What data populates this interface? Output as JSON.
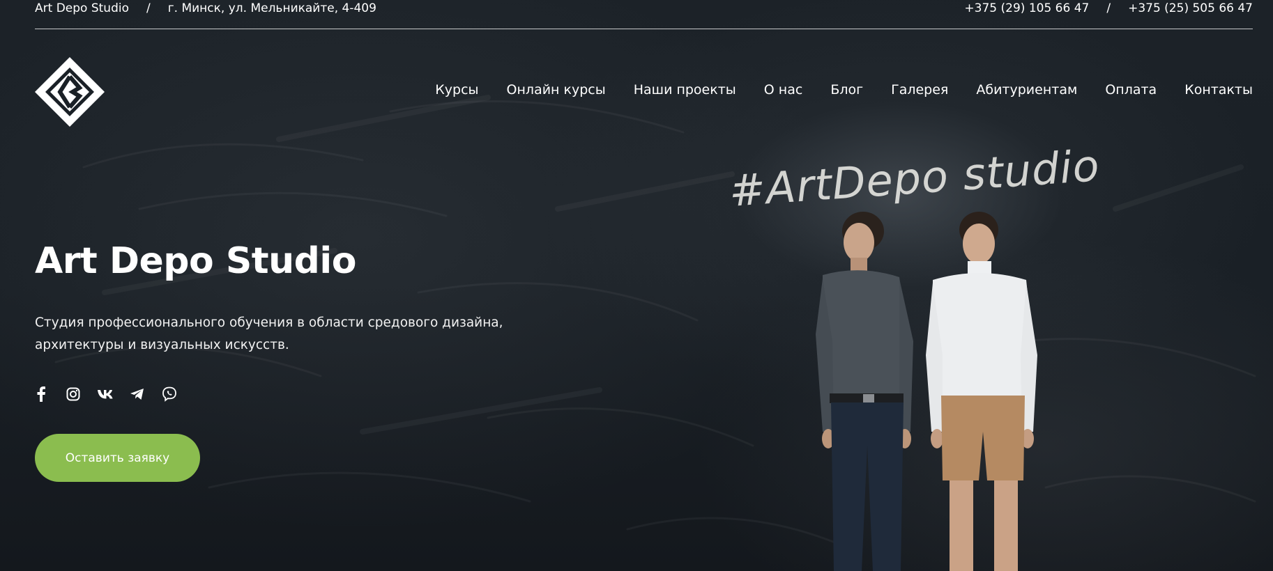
{
  "topbar": {
    "studio_name": "Art Depo Studio",
    "separator": "/",
    "address": "г. Минск, ул. Мельникайте, 4-409",
    "phone_1": "+375 (29) 105 66 47",
    "phone_2": "+375 (25) 505 66 47"
  },
  "logo": {
    "icon": "diamond-logo-icon"
  },
  "nav": {
    "items": [
      {
        "label": "Курсы"
      },
      {
        "label": "Онлайн курсы"
      },
      {
        "label": "Наши проекты"
      },
      {
        "label": "О нас"
      },
      {
        "label": "Блог"
      },
      {
        "label": "Галерея"
      },
      {
        "label": "Абитуриентам"
      },
      {
        "label": "Оплата"
      },
      {
        "label": "Контакты"
      }
    ]
  },
  "hero": {
    "title": "Art Depo Studio",
    "subtitle": "Студия профессионального обучения в области средового дизайна, архитектуры и визуальных искусств.",
    "chalk_text": "#ArtDepo studio",
    "cta_label": "Оставить заявку"
  },
  "social": [
    {
      "icon": "facebook-icon"
    },
    {
      "icon": "instagram-icon"
    },
    {
      "icon": "vk-icon"
    },
    {
      "icon": "telegram-icon"
    },
    {
      "icon": "viber-icon"
    }
  ],
  "colors": {
    "background": "#1a2026",
    "accent": "#8bbd4f",
    "text": "#ffffff"
  }
}
